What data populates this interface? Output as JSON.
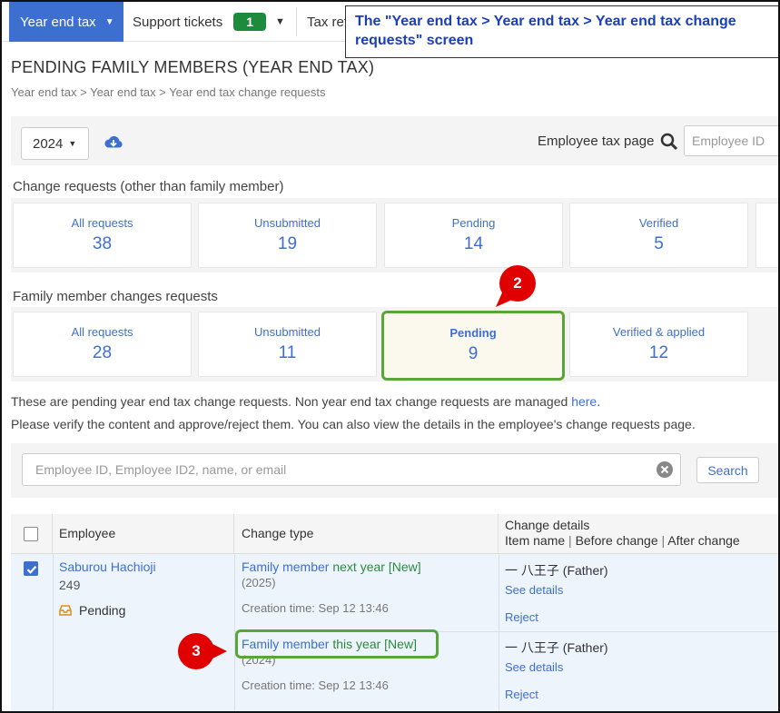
{
  "nav": {
    "year_end_tax": "Year end tax",
    "support_tickets": "Support tickets",
    "support_count": "1",
    "tax_returns": "Tax ret"
  },
  "callout": "The \"Year end tax > Year end tax > Year end tax change requests\" screen",
  "page": {
    "title": "PENDING FAMILY MEMBERS (YEAR END TAX)",
    "breadcrumb": "Year end tax > Year end tax > Year end tax change requests"
  },
  "toolbar": {
    "year": "2024",
    "employee_tax_label": "Employee tax page",
    "employee_id_placeholder": "Employee ID"
  },
  "change_requests": {
    "label": "Change requests (other than family member)",
    "cards": [
      {
        "label": "All requests",
        "count": "38"
      },
      {
        "label": "Unsubmitted",
        "count": "19"
      },
      {
        "label": "Pending",
        "count": "14"
      },
      {
        "label": "Verified",
        "count": "5"
      }
    ]
  },
  "family_requests": {
    "label": "Family member changes requests",
    "cards": [
      {
        "label": "All requests",
        "count": "28"
      },
      {
        "label": "Unsubmitted",
        "count": "11"
      },
      {
        "label": "Pending",
        "count": "9"
      },
      {
        "label": "Verified & applied",
        "count": "12"
      }
    ]
  },
  "markers": {
    "two": "2",
    "three": "3"
  },
  "info": {
    "line1_prefix": "These are pending year end tax change requests. Non year end tax change requests are managed ",
    "line1_link": "here",
    "line1_suffix": ".",
    "line2": "Please verify the content and approve/reject them. You can also view the details in the employee's change requests page."
  },
  "search": {
    "placeholder": "Employee ID, Employee ID2, name, or email",
    "button": "Search"
  },
  "table": {
    "headers": {
      "employee": "Employee",
      "change_type": "Change type",
      "details_line1": "Change details",
      "details_line2_a": "Item name",
      "details_line2_b": "Before change",
      "details_line2_c": "After change",
      "separator": "|"
    },
    "row": {
      "name": "Saburou Hachioji",
      "id": "249",
      "status": "Pending",
      "changes": [
        {
          "type_a": "Family member",
          "type_b": "next year",
          "tag": "[New]",
          "year": "(2025)",
          "created": "Creation time: Sep 12 13:46",
          "item": "一 八王子",
          "relation": "(Father)",
          "see_details": "See details",
          "reject": "Reject"
        },
        {
          "type_a": "Family member",
          "type_b": "this year",
          "tag": "[New]",
          "year": "(2024)",
          "created": "Creation time: Sep 12 13:46",
          "item": "一 八王子",
          "relation": "(Father)",
          "see_details": "See details",
          "reject": "Reject"
        }
      ]
    }
  },
  "colors": {
    "accent": "#3d6fd1",
    "badge_green": "#1e8a3c",
    "highlight_green": "#5aa53a",
    "marker_red": "#e00000",
    "callout_text": "#1a3fb8"
  }
}
